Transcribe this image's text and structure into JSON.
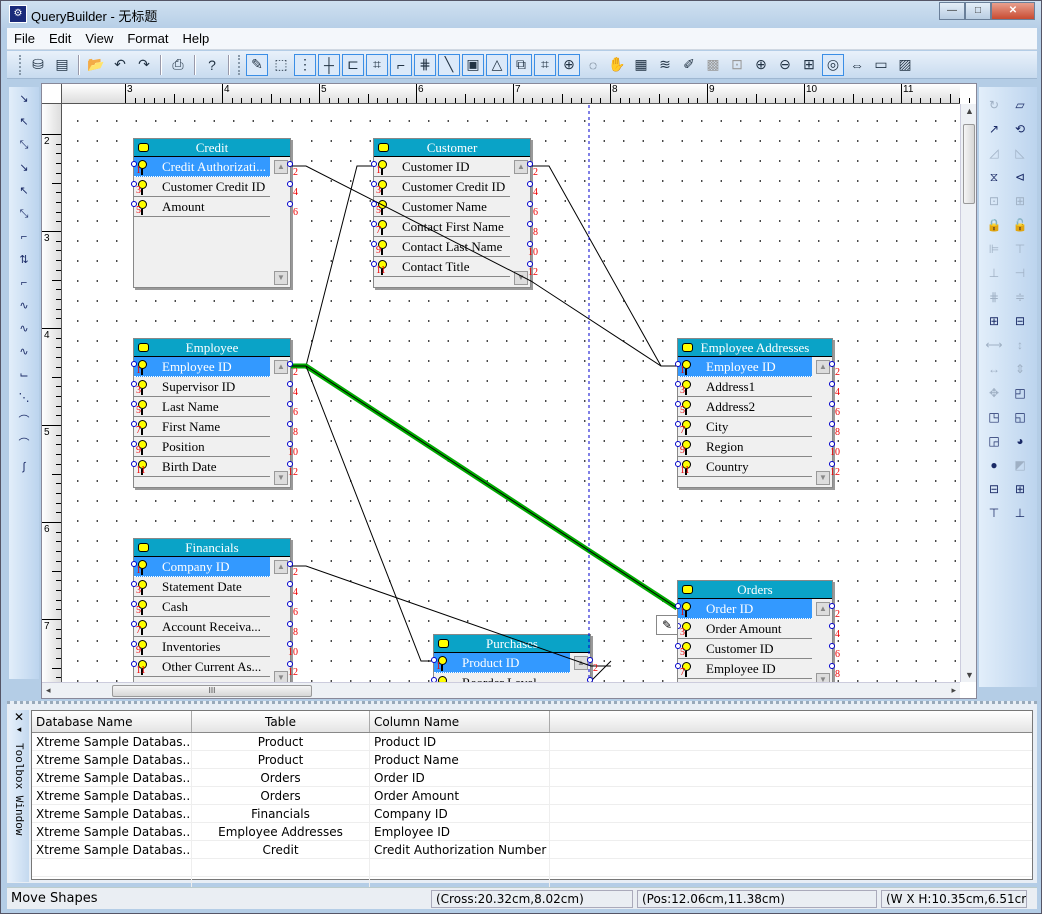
{
  "window": {
    "title": "QueryBuilder - 无标题",
    "controls": {
      "minimize": "—",
      "maximize": "□",
      "close": "✕"
    }
  },
  "menu": [
    {
      "label": "File",
      "accel": "F"
    },
    {
      "label": "Edit",
      "accel": "E"
    },
    {
      "label": "View",
      "accel": "V"
    },
    {
      "label": "Format",
      "accel": ""
    },
    {
      "label": "Help",
      "accel": "H"
    }
  ],
  "toolbar": {
    "groups": [
      [
        "new-db-icon",
        "new-table-icon"
      ],
      [
        "open-icon",
        "undo-icon",
        "redo-icon"
      ],
      [
        "print-icon"
      ],
      [
        "help-icon"
      ],
      [
        "design-mode-icon",
        "select-icon",
        "grid-icon",
        "crosshair-icon",
        "connect-icon",
        "snap-icon",
        "ortho-icon",
        "guides-icon",
        "line-icon",
        "rect-select-icon",
        "triangle-icon",
        "link-icon",
        "frame-icon",
        "node-icon",
        "zoom-dynamic-icon",
        "pan-hand-icon",
        "properties-icon",
        "layers-icon",
        "format-painter-icon",
        "group-icon",
        "ungroup-icon",
        "zoom-in-icon",
        "zoom-out-icon",
        "zoom-area-icon",
        "zoom-fit-icon",
        "zoom-width-icon",
        "zoom-page-icon",
        "zoom-selection-icon"
      ]
    ],
    "glyphs": {
      "new-db-icon": "⛁",
      "new-table-icon": "▤",
      "open-icon": "📂",
      "undo-icon": "↶",
      "redo-icon": "↷",
      "print-icon": "⎙",
      "help-icon": "?",
      "design-mode-icon": "✎",
      "select-icon": "⬚",
      "grid-icon": "⋮",
      "crosshair-icon": "┼",
      "connect-icon": "⊏",
      "snap-icon": "⌗",
      "ortho-icon": "⌐",
      "guides-icon": "⋕",
      "line-icon": "╲",
      "rect-select-icon": "▣",
      "triangle-icon": "△",
      "link-icon": "⧉",
      "frame-icon": "⌗",
      "node-icon": "⊕",
      "zoom-dynamic-icon": "◌",
      "pan-hand-icon": "✋",
      "properties-icon": "▦",
      "layers-icon": "≋",
      "format-painter-icon": "✐",
      "group-icon": "▩",
      "ungroup-icon": "⊡",
      "zoom-in-icon": "⊕",
      "zoom-out-icon": "⊖",
      "zoom-area-icon": "⊞",
      "zoom-fit-icon": "◎",
      "zoom-width-icon": "⇔",
      "zoom-page-icon": "▭",
      "zoom-selection-icon": "▨"
    }
  },
  "left_tools": [
    "line-connector",
    "arrow-start",
    "arrow-both",
    "curve-connector",
    "curve-arrow-start",
    "curve-arrow-both",
    "orthogonal-connector",
    "orthogonal-arrow-both",
    "orthogonal-arrow-start",
    "zigzag-connector",
    "zigzag-arrow-start",
    "zigzag-arrow-both",
    "polyline-connector",
    "spline-connector",
    "arc-connector",
    "bezier-connector",
    "s-curve-connector"
  ],
  "left_glyphs": [
    "↘",
    "↖",
    "⤡",
    "↘",
    "↖",
    "⤡",
    "⌐",
    "⇅",
    "⌐",
    "∿",
    "∿",
    "∿",
    "⌙",
    "⋱",
    "⌒",
    "⌒",
    "∫"
  ],
  "right_tools": [
    {
      "n": "rotate",
      "g": "↻",
      "dim": true
    },
    {
      "n": "skew",
      "g": "▱",
      "dim": false
    },
    {
      "n": "rotate-free",
      "g": "↗",
      "dim": false
    },
    {
      "n": "flip-rotate",
      "g": "⟲",
      "dim": false
    },
    {
      "n": "mirror-left",
      "g": "◿",
      "dim": true
    },
    {
      "n": "mirror-right",
      "g": "◺",
      "dim": true
    },
    {
      "n": "flip-horizontal",
      "g": "⧖",
      "dim": false
    },
    {
      "n": "flip-vertical",
      "g": "⊲",
      "dim": false
    },
    {
      "n": "group",
      "g": "⊡",
      "dim": true
    },
    {
      "n": "ungroup",
      "g": "⊞",
      "dim": true
    },
    {
      "n": "lock",
      "g": "🔒",
      "dim": false
    },
    {
      "n": "unlock",
      "g": "🔓",
      "dim": false
    },
    {
      "n": "align-left",
      "g": "⊫",
      "dim": true
    },
    {
      "n": "align-top",
      "g": "⊤",
      "dim": true
    },
    {
      "n": "align-bottom",
      "g": "⊥",
      "dim": true
    },
    {
      "n": "align-right",
      "g": "⊣",
      "dim": true
    },
    {
      "n": "align-center-h",
      "g": "⋕",
      "dim": true
    },
    {
      "n": "align-center-v",
      "g": "≑",
      "dim": true
    },
    {
      "n": "space-horizontal",
      "g": "⊞",
      "dim": false
    },
    {
      "n": "space-vertical",
      "g": "⊟",
      "dim": false
    },
    {
      "n": "same-width-gap",
      "g": "⟷",
      "dim": true
    },
    {
      "n": "same-height-gap",
      "g": "↕",
      "dim": true
    },
    {
      "n": "same-width",
      "g": "↔",
      "dim": true
    },
    {
      "n": "same-height",
      "g": "⇕",
      "dim": true
    },
    {
      "n": "same-size",
      "g": "✥",
      "dim": true
    },
    {
      "n": "bring-front",
      "g": "◰",
      "dim": false
    },
    {
      "n": "send-back",
      "g": "◳",
      "dim": false
    },
    {
      "n": "bring-forward",
      "g": "◱",
      "dim": false
    },
    {
      "n": "send-backward",
      "g": "◲",
      "dim": false
    },
    {
      "n": "send-to-back-shape",
      "g": "◕",
      "dim": false
    },
    {
      "n": "fill-color",
      "g": "●",
      "dim": false
    },
    {
      "n": "shadow",
      "g": "◩",
      "dim": true
    },
    {
      "n": "expand-left",
      "g": "⊟",
      "dim": false
    },
    {
      "n": "expand-right",
      "g": "⊞",
      "dim": false
    },
    {
      "n": "expand-up",
      "g": "⊤",
      "dim": false
    },
    {
      "n": "expand-down",
      "g": "⊥",
      "dim": false
    }
  ],
  "ruler": {
    "h_labels": [
      "3",
      "4",
      "5",
      "6",
      "7",
      "8",
      "9",
      "10",
      "11"
    ],
    "v_labels": [
      "2",
      "3",
      "4",
      "5",
      "6",
      "7"
    ]
  },
  "tables": [
    {
      "id": "credit",
      "title": "Credit",
      "rows": [
        "Credit Authorizati...",
        "Customer Credit ID",
        "Amount"
      ],
      "selected": 0
    },
    {
      "id": "customer",
      "title": "Customer",
      "rows": [
        "Customer ID",
        "Customer Credit ID",
        "Customer Name",
        "Contact First Name",
        "Contact Last Name",
        "Contact Title"
      ],
      "selected": -1
    },
    {
      "id": "employee",
      "title": "Employee",
      "rows": [
        "Employee ID",
        "Supervisor ID",
        "Last Name",
        "First Name",
        "Position",
        "Birth Date"
      ],
      "selected": 0
    },
    {
      "id": "employee-addresses",
      "title": "Employee Addresses",
      "rows": [
        "Employee ID",
        "Address1",
        "Address2",
        "City",
        "Region",
        "Country"
      ],
      "selected": 0
    },
    {
      "id": "financials",
      "title": "Financials",
      "rows": [
        "Company ID",
        "Statement Date",
        "Cash",
        "Account Receiva...",
        "Inventories",
        "Other Current As..."
      ],
      "selected": 0
    },
    {
      "id": "purchases",
      "title": "Purchases",
      "rows": [
        "Product ID",
        "Reorder Level"
      ],
      "selected": 0
    },
    {
      "id": "orders",
      "title": "Orders",
      "rows": [
        "Order ID",
        "Order Amount",
        "Customer ID",
        "Employee ID"
      ],
      "selected": 0
    }
  ],
  "toolbox": {
    "label": "Toolbox Window",
    "close": "✕",
    "pin": "◂"
  },
  "grid": {
    "headers": [
      "Database Name",
      "Table",
      "Column Name",
      ""
    ],
    "rows": [
      [
        "Xtreme Sample Databas...",
        "Product",
        "Product ID"
      ],
      [
        "Xtreme Sample Databas...",
        "Product",
        "Product Name"
      ],
      [
        "Xtreme Sample Databas...",
        "Orders",
        "Order ID"
      ],
      [
        "Xtreme Sample Databas...",
        "Orders",
        "Order Amount"
      ],
      [
        "Xtreme Sample Databas...",
        "Financials",
        "Company ID"
      ],
      [
        "Xtreme Sample Databas...",
        "Employee Addresses",
        "Employee ID"
      ],
      [
        "Xtreme Sample Databas...",
        "Credit",
        "Credit Authorization Number"
      ]
    ]
  },
  "status": {
    "mode": "Move Shapes",
    "cross": "(Cross:20.32cm,8.02cm)",
    "pos": "(Pos:12.06cm,11.38cm)",
    "size": "(W X H:10.35cm,6.51cr"
  },
  "colors": {
    "table_header": "#0aa3c7",
    "selected_row": "#3399ff",
    "highlight_link": "#22cc22"
  }
}
